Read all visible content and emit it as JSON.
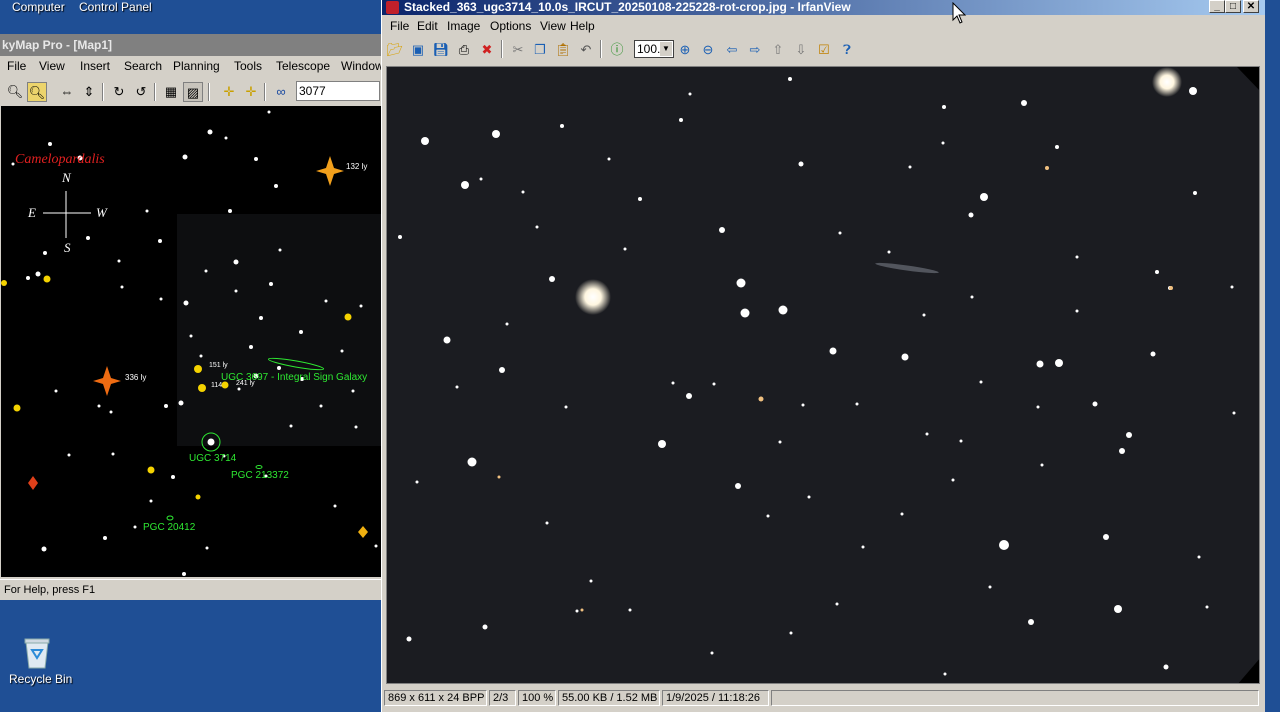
{
  "desktop": {
    "top_links": [
      "Computer",
      "Control Panel"
    ],
    "recycle_bin_label": "Recycle Bin"
  },
  "skymap": {
    "title": "kyMap Pro - [Map1]",
    "menu": [
      "File",
      "View",
      "Insert",
      "Search",
      "Planning",
      "Tools",
      "Telescope",
      "Window"
    ],
    "search_value": "3077",
    "constellation": "Camelopardalis",
    "compass": {
      "n": "N",
      "s": "S",
      "e": "E",
      "w": "W"
    },
    "labels": {
      "ugc3697": "UGC 3697 - Integral Sign Galaxy",
      "ugc3714": "UGC 3714",
      "pgc213372": "PGC 213372",
      "pgc20412": "PGC 20412",
      "ly132": "132 ly",
      "ly336": "336 ly",
      "ly151": "151 ly",
      "ly114": "114",
      "ly241": "241 ly"
    },
    "status": "For Help, press F1"
  },
  "irfanview": {
    "title": "Stacked_363_ugc3714_10.0s_IRCUT_20250108-225228-rot-crop.jpg - IrfanView",
    "menu": [
      "File",
      "Edit",
      "Image",
      "Options",
      "View",
      "Help"
    ],
    "zoom_value": "100.",
    "status": {
      "dimensions": "869 x 611 x 24 BPP",
      "index": "2/3",
      "zoom": "100 %",
      "size": "55.00 KB / 1.52 MB",
      "datetime": "1/9/2025 / 11:18:26"
    }
  }
}
